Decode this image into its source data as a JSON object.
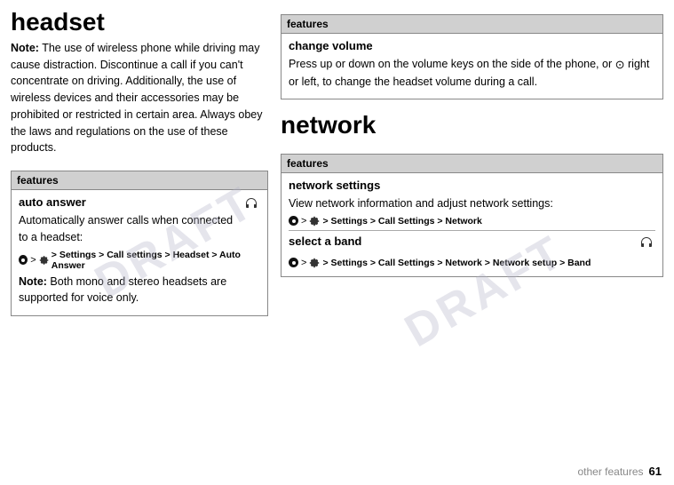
{
  "page": {
    "left_title": "headset",
    "note_intro": "Note:",
    "note_text": " The use of wireless phone while driving may cause distraction. Discontinue a call if you can't concentrate on driving. Additionally, the use of wireless devices and their accessories may be prohibited or restricted in certain area. Always obey the laws and regulations on the use of these products.",
    "left_table": {
      "header": "features",
      "rows": [
        {
          "title": "auto answer",
          "has_icon": true,
          "desc": "Automatically answer calls when connected to a headset:",
          "path": "> Settings > Call settings > Headset > Auto Answer",
          "note_label": "Note:",
          "note_text": " Both mono and stereo headsets are supported for voice only."
        }
      ]
    },
    "right_section1": {
      "header": "features",
      "title": "change volume",
      "desc1": "Press up or down on the volume keys on the side of the phone, or",
      "desc2": "right or left, to change the headset volume during a call.",
      "nav_symbol": "⊙"
    },
    "right_title": "network",
    "right_table": {
      "header": "features",
      "rows": [
        {
          "title": "network settings",
          "desc": "View network information and adjust network settings:",
          "path": "> Settings > Call Settings > Network"
        },
        {
          "title": "select a band",
          "has_icon": true,
          "path": "> Settings > Call Settings > Network > Network setup > Band"
        }
      ]
    }
  },
  "footer": {
    "label": "other features",
    "page_number": "61"
  }
}
